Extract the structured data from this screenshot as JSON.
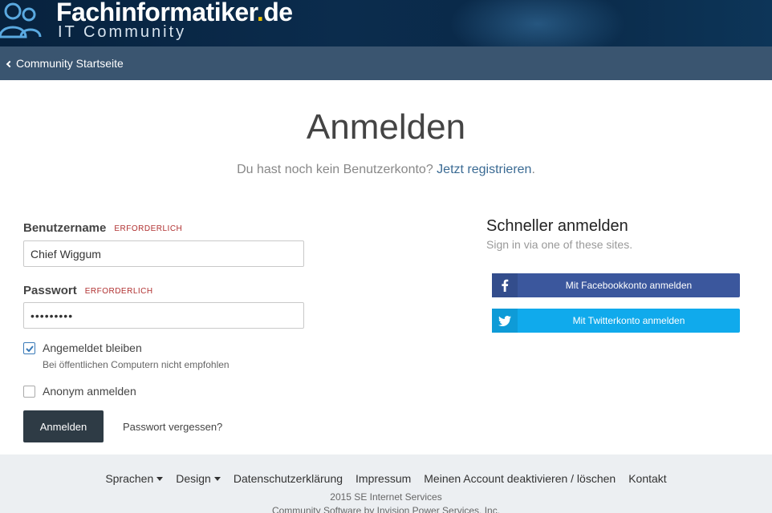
{
  "header": {
    "brand_name": "Fachinformatiker",
    "brand_dot": ".",
    "brand_tld": "de",
    "brand_tagline": "IT Community"
  },
  "nav": {
    "back_label": "Community Startseite"
  },
  "login": {
    "title": "Anmelden",
    "subtitle_prefix": "Du hast noch kein Benutzerkonto?",
    "register_link": "Jetzt registrieren",
    "subtitle_suffix": ".",
    "username_label": "Benutzername",
    "password_label": "Passwort",
    "required_label": "ERFORDERLICH",
    "username_value": "Chief Wiggum",
    "password_value": "•••••••••",
    "remember_label": "Angemeldet bleiben",
    "remember_checked": true,
    "remember_help": "Bei öffentlichen Computern nicht empfohlen",
    "anonymous_label": "Anonym anmelden",
    "anonymous_checked": false,
    "submit_label": "Anmelden",
    "forgot_label": "Passwort vergessen?"
  },
  "fast_login": {
    "title": "Schneller anmelden",
    "subtitle": "Sign in via one of these sites.",
    "facebook_label": "Mit Facebookkonto anmelden",
    "twitter_label": "Mit Twitterkonto anmelden"
  },
  "footer": {
    "links": [
      "Sprachen",
      "Design",
      "Datenschutzerklärung",
      "Impressum",
      "Meinen Account deaktivieren / löschen",
      "Kontakt"
    ],
    "copyright": "2015 SE Internet Services",
    "powered": "Community Software by Invision Power Services, Inc."
  },
  "colors": {
    "header_bg": "#0b2c4d",
    "navbar_bg": "#3a5570",
    "accent_link": "#3a6a93",
    "required": "#b03030",
    "facebook": "#3b579d",
    "twitter": "#10aaec",
    "button_dark": "#2e3b45"
  }
}
